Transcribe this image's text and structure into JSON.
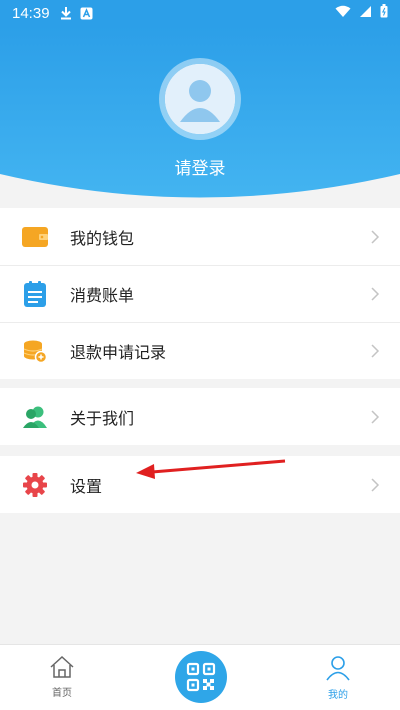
{
  "status_bar": {
    "time": "14:39",
    "icons": [
      "download-icon",
      "a-badge-icon",
      "wifi-icon",
      "signal-icon",
      "battery-icon"
    ]
  },
  "header": {
    "login_text": "请登录",
    "avatar_icon": "user-avatar-icon"
  },
  "menu": {
    "group1": [
      {
        "label": "我的钱包",
        "icon": "wallet-icon",
        "color": "#f5a623"
      },
      {
        "label": "消费账单",
        "icon": "bill-icon",
        "color": "#2c9fe8"
      },
      {
        "label": "退款申请记录",
        "icon": "refund-icon",
        "color": "#f5a623"
      }
    ],
    "group2": [
      {
        "label": "关于我们",
        "icon": "about-us-icon",
        "color": "#3cbf7d"
      }
    ],
    "group3": [
      {
        "label": "设置",
        "icon": "gear-icon",
        "color": "#e8454a"
      }
    ]
  },
  "bottom_nav": {
    "home_label": "首页",
    "center_icon": "qr-code-icon",
    "mine_label": "我的",
    "active": "我的"
  },
  "colors": {
    "primary": "#2c9fe8",
    "annotation_arrow": "#e02020"
  }
}
